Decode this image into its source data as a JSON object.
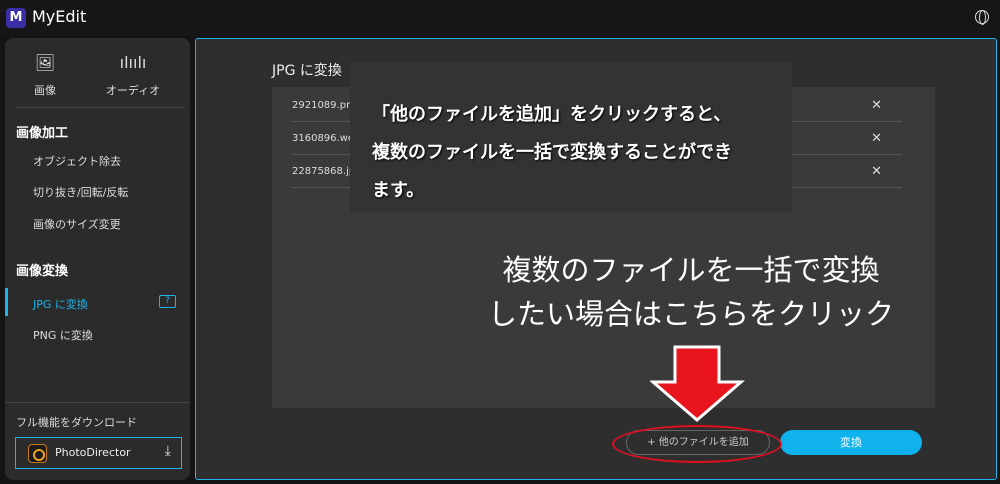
{
  "app": {
    "title": "MyEdit",
    "logo": "M"
  },
  "sidebar": {
    "modes": [
      {
        "label": "画像",
        "icon": "image-icon"
      },
      {
        "label": "オーディオ",
        "icon": "audio-wave-icon"
      }
    ],
    "sections": [
      {
        "title": "画像加工",
        "items": [
          "オブジェクト除去",
          "切り抜き/回転/反転",
          "画像のサイズ変更"
        ]
      },
      {
        "title": "画像変換",
        "items": [
          "JPG に変換",
          "PNG に変換"
        ]
      }
    ],
    "download_label": "フル機能をダウンロード",
    "download_app": "PhotoDirector"
  },
  "main": {
    "title": "JPG に変換",
    "files": [
      "2921089.pn",
      "3160896.we",
      "22875868.jp"
    ],
    "add_button": "+ 他のファイルを追加",
    "convert_button": "変換"
  },
  "annotation": {
    "tooltip_lines": [
      "「他のファイルを追加」をクリックすると、",
      "複数のファイルを一括で変換することができ",
      "ます。"
    ],
    "callout_lines": [
      "複数のファイルを一括で変換",
      "したい場合はこちらをクリック"
    ]
  },
  "colors": {
    "accent": "#1fb3e8",
    "annotation": "#e01020"
  }
}
